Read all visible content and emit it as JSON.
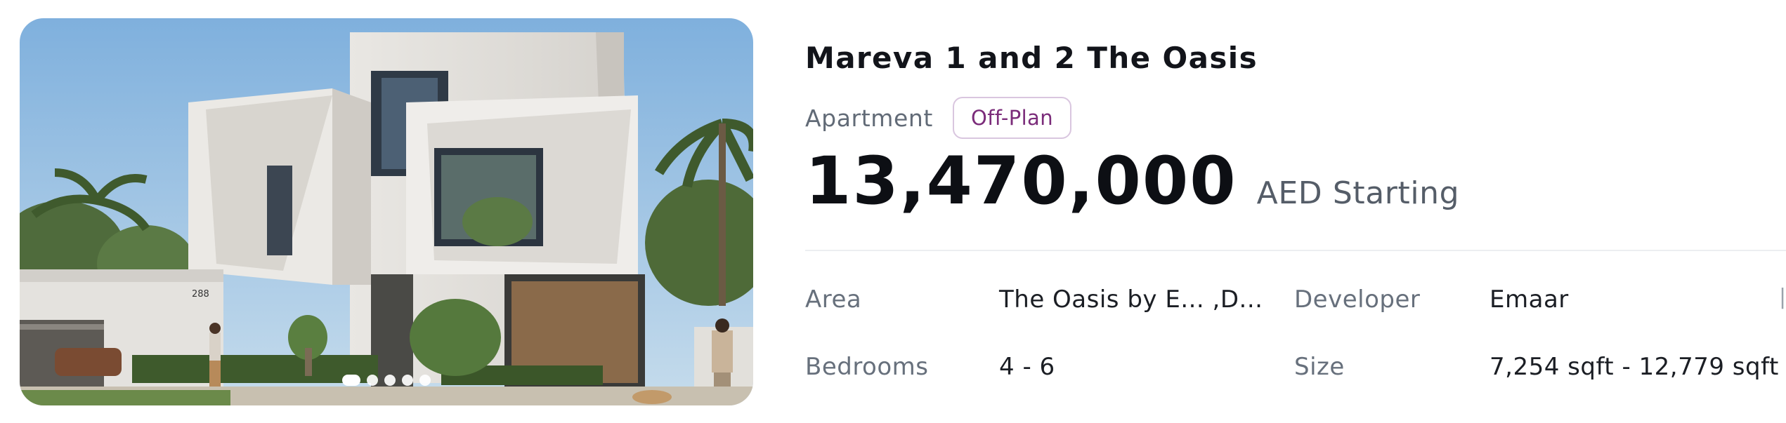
{
  "listing": {
    "title": "Mareva 1 and 2 The Oasis",
    "property_type": "Apartment",
    "status_badge": "Off-Plan",
    "price": "13,470,000",
    "price_suffix": "AED Starting",
    "gallery": {
      "image_count": 5,
      "active_index": 0,
      "house_number": "288"
    }
  },
  "details": {
    "area_label": "Area",
    "area_value": "The Oasis by E... ,D...",
    "developer_label": "Developer",
    "developer_value": "Emaar",
    "bedrooms_label": "Bedrooms",
    "bedrooms_value": "4 - 6",
    "size_label": "Size",
    "size_value": "7,254 sqft - 12,779 sqft"
  },
  "colors": {
    "badge_text": "#7b2c7a",
    "badge_border": "#d9c6df",
    "label_text": "#67707c",
    "title_text": "#12141a"
  }
}
